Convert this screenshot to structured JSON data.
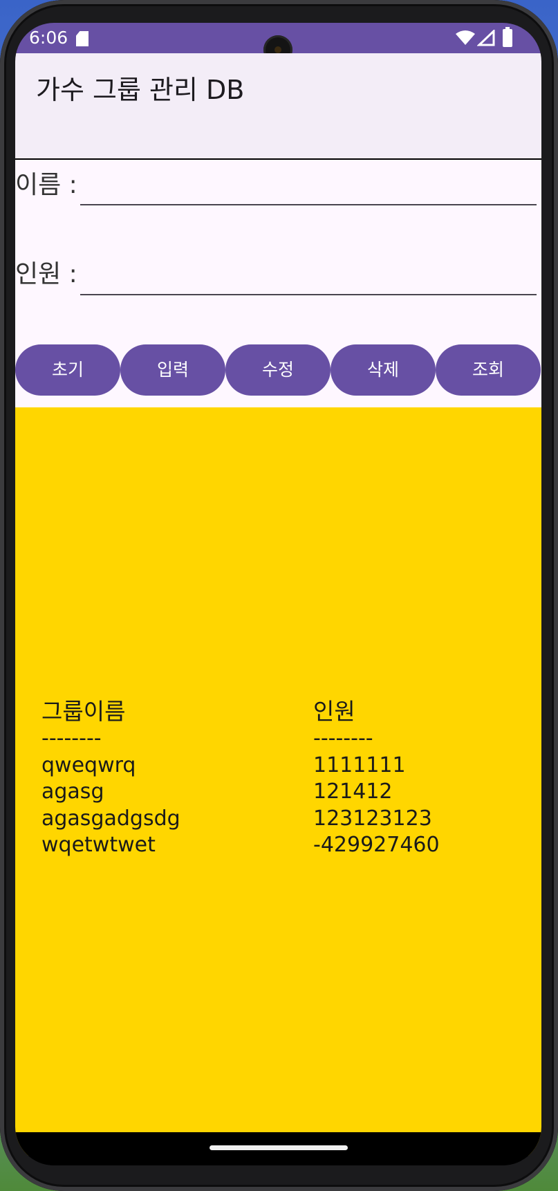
{
  "status_bar": {
    "time": "6:06",
    "icons": [
      "sd-card-icon",
      "wifi-icon",
      "signal-icon",
      "battery-icon"
    ]
  },
  "app_bar": {
    "title": "가수 그룹 관리 DB"
  },
  "form": {
    "name_label": "이름 :",
    "name_value": "",
    "count_label": "인원 :",
    "count_value": ""
  },
  "buttons": {
    "reset": "초기",
    "insert": "입력",
    "update": "수정",
    "delete": "삭제",
    "select": "조회"
  },
  "results": {
    "name_header": "그룹이름",
    "count_header": "인원",
    "separator": "--------",
    "rows": [
      {
        "name": "qweqwrq",
        "count": "1111111"
      },
      {
        "name": "agasg",
        "count": "121412"
      },
      {
        "name": "agasgadgsdg",
        "count": "123123123"
      },
      {
        "name": "wqetwtwet",
        "count": "-429927460"
      }
    ]
  },
  "colors": {
    "primary": "#6750a4",
    "app_bar_bg": "#f3edf7",
    "content_bg": "#fef7ff",
    "result_bg": "#ffd600"
  }
}
